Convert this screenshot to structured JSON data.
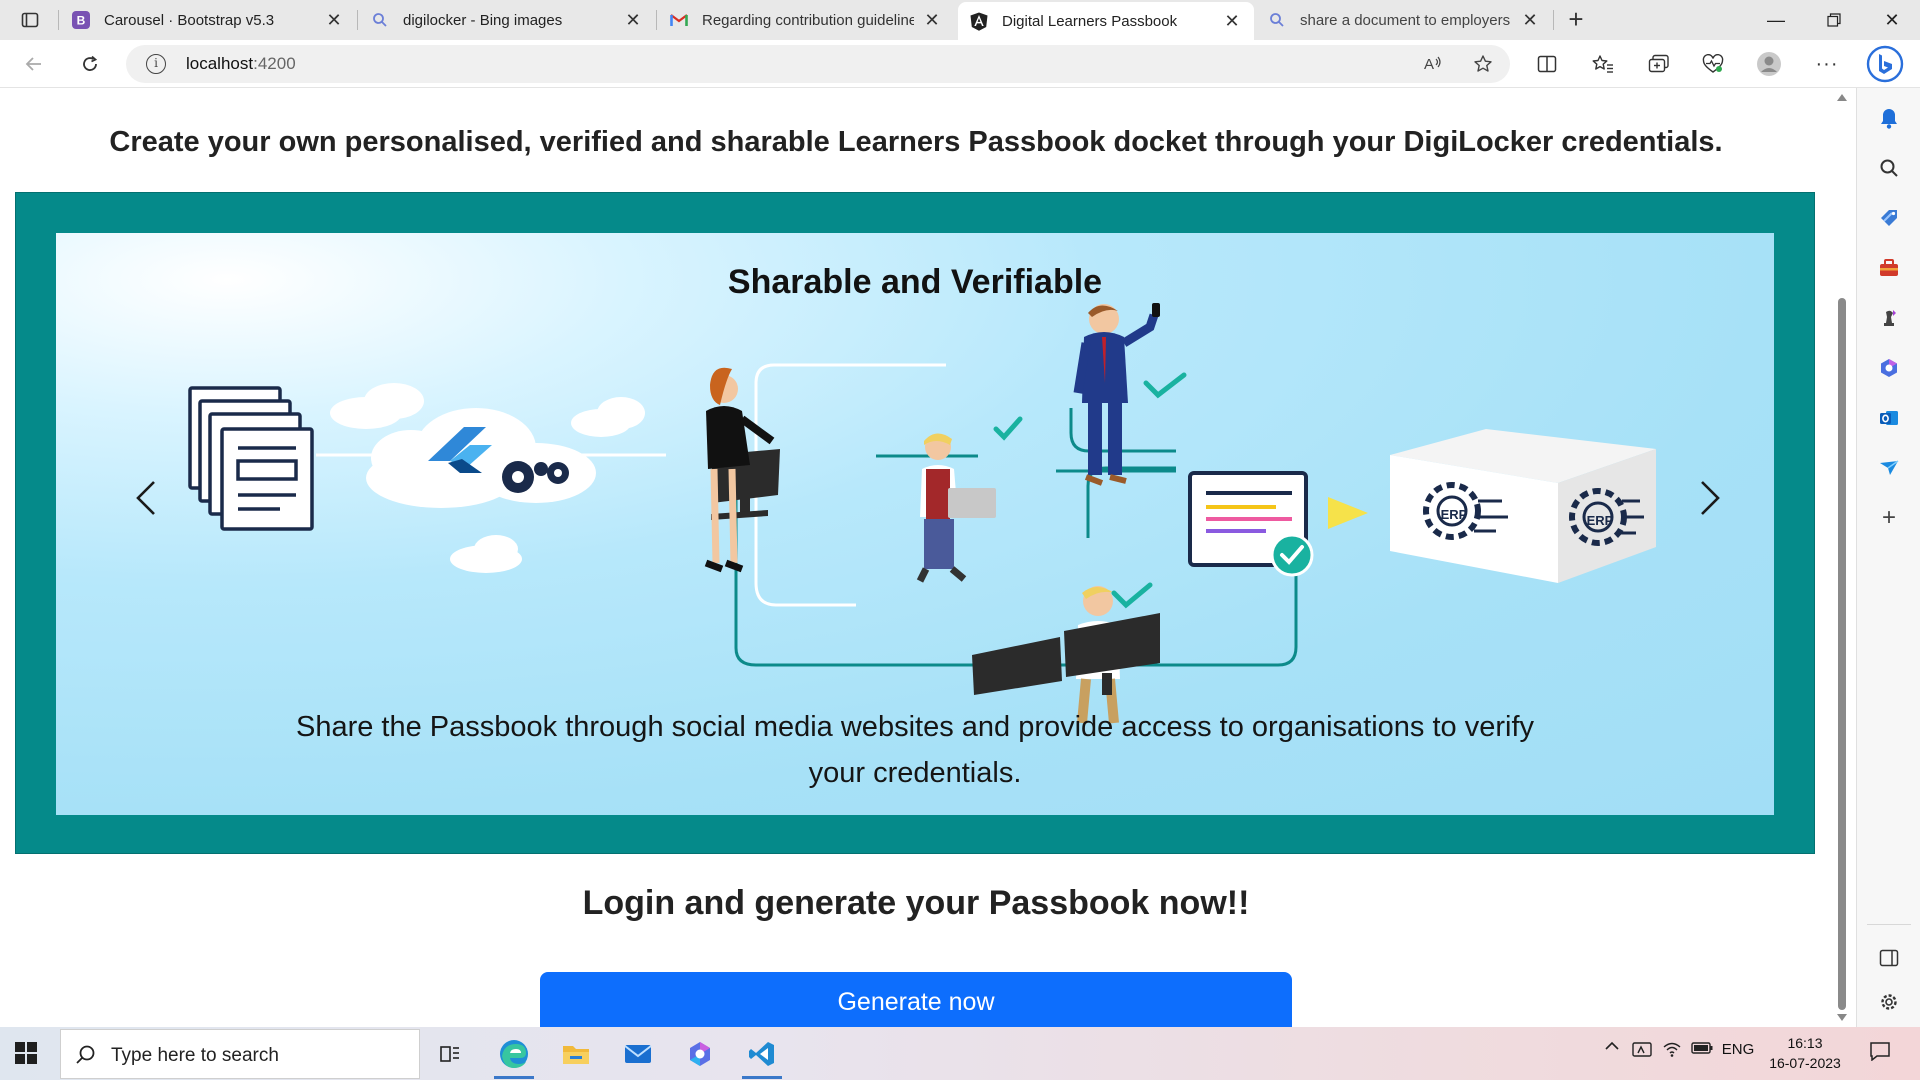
{
  "browser": {
    "tabs": [
      {
        "title": "Carousel · Bootstrap v5.3",
        "favicon": "bootstrap-icon",
        "active": false
      },
      {
        "title": "digilocker - Bing images",
        "favicon": "search-icon",
        "active": false
      },
      {
        "title": "Regarding contribution guideline",
        "favicon": "gmail-icon",
        "active": false
      },
      {
        "title": "Digital Learners Passbook",
        "favicon": "angular-icon",
        "active": true
      },
      {
        "title": "share a document to employers c",
        "favicon": "search-icon",
        "active": false
      }
    ],
    "address": {
      "host": "localhost",
      "port": ":4200"
    },
    "colors": {
      "accent": "#0d6efd",
      "carousel_frame": "#058a8a",
      "tab_strip": "#e8e8e8"
    }
  },
  "page": {
    "headline": "Create your own personalised, verified and sharable Learners Passbook docket through your DigiLocker credentials.",
    "carousel": {
      "slide_title": "Sharable and Verifiable",
      "slide_caption": "Share the Passbook through social media websites and provide access to organisations to verify your credentials.",
      "erp_label": "ERP"
    },
    "login_heading": "Login and generate your Passbook now!!",
    "generate_button": "Generate now"
  },
  "taskbar": {
    "search_placeholder": "Type here to search",
    "language": "ENG",
    "time": "16:13",
    "date": "16-07-2023"
  }
}
